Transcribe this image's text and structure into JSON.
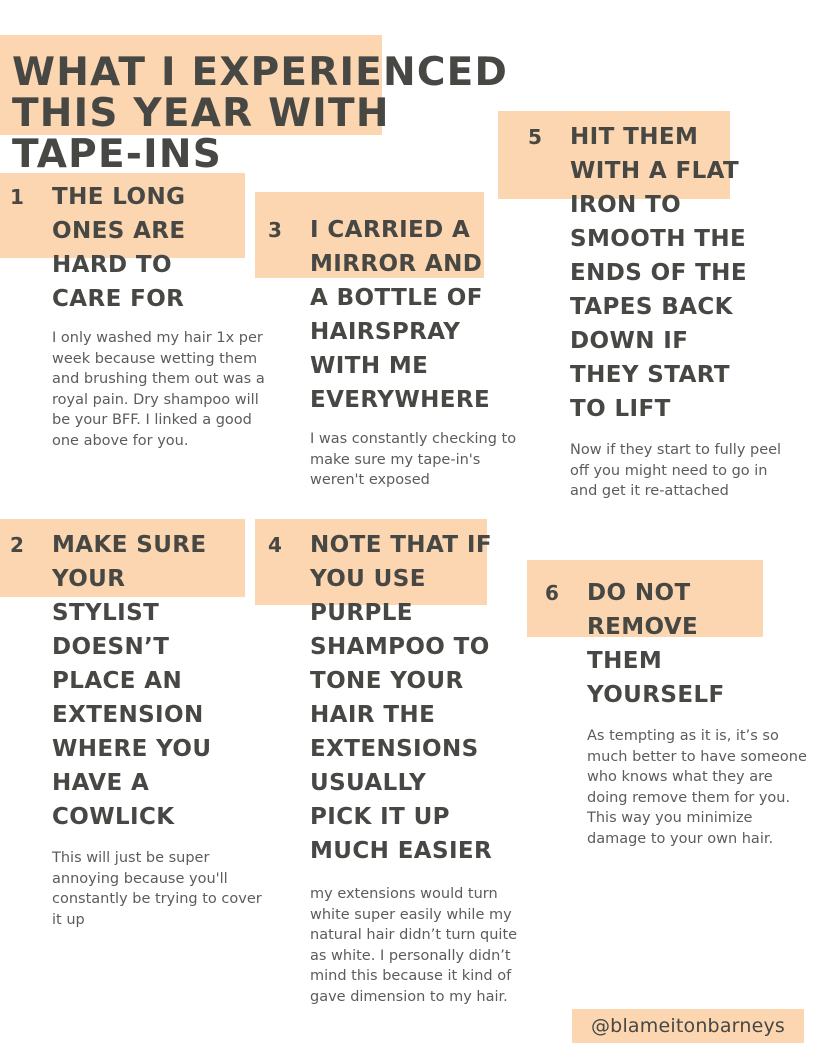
{
  "document": {
    "kind": "infographic",
    "background_color": "#ffffff",
    "highlight_color": "#fbd6b0",
    "heading_color": "#474744",
    "body_color": "#5c5c5c"
  },
  "title": "WHAT I EXPERIENCED\nTHIS YEAR WITH\nTAPE-INS",
  "items": [
    {
      "number": "1",
      "heading": "THE LONG\nONES ARE\nHARD TO\nCARE FOR",
      "body": "I only washed my hair 1x per week because wetting them and brushing them out was a royal pain. Dry shampoo will be your BFF. I linked a good one above for you."
    },
    {
      "number": "2",
      "heading": "MAKE SURE\nYOUR\nSTYLIST\nDOESN’T\nPLACE AN\nEXTENSION\nWHERE YOU\nHAVE A\nCOWLICK",
      "body": "This will just be super annoying because you'll constantly be trying to cover it up"
    },
    {
      "number": "3",
      "heading": "I CARRIED A\nMIRROR AND\nA BOTTLE OF\nHAIRSPRAY\nWITH ME\nEVERYWHERE",
      "body": "I was constantly checking to make sure my tape-in's weren't exposed"
    },
    {
      "number": "4",
      "heading": "NOTE THAT IF\nYOU USE\nPURPLE\nSHAMPOO TO\nTONE YOUR\nHAIR THE\nEXTENSIONS\nUSUALLY\nPICK IT UP\nMUCH EASIER",
      "body": "my extensions would turn white super easily while my natural hair didn’t turn quite as white. I personally didn’t mind this because it kind of gave dimension to my hair."
    },
    {
      "number": "5",
      "heading": "HIT THEM\nWITH A FLAT\nIRON TO\nSMOOTH THE\nENDS OF THE\nTAPES BACK\nDOWN IF\nTHEY START\nTO LIFT",
      "body": "Now if they start to fully peel off you might need to go in and get it re-attached"
    },
    {
      "number": "6",
      "heading": "DO NOT\nREMOVE\nTHEM\nYOURSELF",
      "body": "As tempting as it is, it’s so much better to have someone who knows what they are doing remove them for you. This way you minimize damage to your own hair."
    }
  ],
  "footer": {
    "handle": "@blameitonbarneys"
  }
}
